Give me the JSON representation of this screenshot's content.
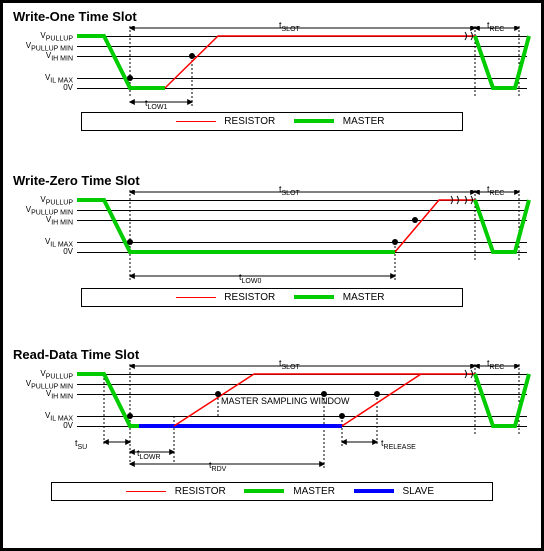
{
  "panels": [
    {
      "title": "Write-One Time Slot",
      "y_labels": [
        "V_PULLUP",
        "V_PULLUP MIN",
        "V_IH MIN",
        "V_IL MAX",
        "0V"
      ],
      "timing_labels": {
        "tslot": "t_SLOT",
        "trec": "t_REC",
        "tlow1": "t_LOW1"
      },
      "legend": [
        {
          "name": "RESISTOR",
          "color": "#ff0000",
          "w": 1
        },
        {
          "name": "MASTER",
          "color": "#00cc00",
          "w": 4
        }
      ]
    },
    {
      "title": "Write-Zero Time Slot",
      "y_labels": [
        "V_PULLUP",
        "V_PULLUP MIN",
        "V_IH MIN",
        "V_IL MAX",
        "0V"
      ],
      "timing_labels": {
        "tslot": "t_SLOT",
        "trec": "t_REC",
        "tlow0": "t_LOW0"
      },
      "legend": [
        {
          "name": "RESISTOR",
          "color": "#ff0000",
          "w": 1
        },
        {
          "name": "MASTER",
          "color": "#00cc00",
          "w": 4
        }
      ]
    },
    {
      "title": "Read-Data Time Slot",
      "y_labels": [
        "V_PULLUP",
        "V_PULLUP MIN",
        "V_IH MIN",
        "V_IL MAX",
        "0V"
      ],
      "timing_labels": {
        "tslot": "t_SLOT",
        "trec": "t_REC",
        "tlowr": "t_LOWR",
        "trdv": "t_RDV",
        "tsu": "t_SU",
        "trelease": "t_RELEASE"
      },
      "sampling_label": "MASTER SAMPLING WINDOW",
      "legend": [
        {
          "name": "RESISTOR",
          "color": "#ff0000",
          "w": 1
        },
        {
          "name": "MASTER",
          "color": "#00cc00",
          "w": 4
        },
        {
          "name": "SLAVE",
          "color": "#0000ff",
          "w": 4
        }
      ]
    }
  ],
  "chart_data": [
    {
      "type": "line",
      "title": "Write-One Time Slot",
      "y_levels": {
        "V_PULLUP": 5,
        "V_PULLUP_MIN": 4.5,
        "V_IH_MIN": 4.0,
        "V_IL_MAX": 1.0,
        "0V": 0
      },
      "x_unit": "normalized t_SLOT",
      "series": [
        {
          "name": "MASTER",
          "color": "#00cc00",
          "points": [
            [
              0,
              5
            ],
            [
              0.06,
              5
            ],
            [
              0.12,
              0
            ],
            [
              0.2,
              0
            ],
            [
              0.2,
              5
            ]
          ]
        },
        {
          "name": "RESISTOR",
          "color": "#ff0000",
          "points": [
            [
              0.2,
              0
            ],
            [
              0.32,
              5
            ],
            [
              0.9,
              5
            ]
          ]
        },
        {
          "name": "MASTER_rec",
          "color": "#00cc00",
          "points": [
            [
              0.9,
              5
            ],
            [
              0.94,
              0
            ],
            [
              1.0,
              0
            ],
            [
              1.0,
              5
            ]
          ]
        }
      ],
      "intervals": {
        "t_SLOT": [
          0.12,
          0.9
        ],
        "t_REC": [
          0.9,
          1.0
        ],
        "t_LOW1": [
          0.12,
          0.26
        ]
      }
    },
    {
      "type": "line",
      "title": "Write-Zero Time Slot",
      "y_levels": {
        "V_PULLUP": 5,
        "V_PULLUP_MIN": 4.5,
        "V_IH_MIN": 4.0,
        "V_IL_MAX": 1.0,
        "0V": 0
      },
      "series": [
        {
          "name": "MASTER",
          "color": "#00cc00",
          "points": [
            [
              0,
              5
            ],
            [
              0.06,
              5
            ],
            [
              0.12,
              0
            ],
            [
              0.72,
              0
            ],
            [
              0.72,
              5
            ]
          ]
        },
        {
          "name": "RESISTOR",
          "color": "#ff0000",
          "points": [
            [
              0.72,
              0
            ],
            [
              0.82,
              5
            ],
            [
              0.9,
              5
            ]
          ]
        },
        {
          "name": "MASTER_rec",
          "color": "#00cc00",
          "points": [
            [
              0.9,
              5
            ],
            [
              0.94,
              0
            ],
            [
              1.0,
              0
            ],
            [
              1.0,
              5
            ]
          ]
        }
      ],
      "intervals": {
        "t_SLOT": [
          0.12,
          0.9
        ],
        "t_REC": [
          0.9,
          1.0
        ],
        "t_LOW0": [
          0.12,
          0.72
        ]
      }
    },
    {
      "type": "line",
      "title": "Read-Data Time Slot",
      "y_levels": {
        "V_PULLUP": 5,
        "V_PULLUP_MIN": 4.5,
        "V_IH_MIN": 4.0,
        "V_IL_MAX": 1.0,
        "0V": 0
      },
      "series": [
        {
          "name": "MASTER",
          "color": "#00cc00",
          "points": [
            [
              0,
              5
            ],
            [
              0.06,
              5
            ],
            [
              0.12,
              0
            ],
            [
              0.22,
              0
            ],
            [
              0.22,
              5
            ]
          ]
        },
        {
          "name": "SLAVE",
          "color": "#0000ff",
          "points": [
            [
              0.14,
              0
            ],
            [
              0.6,
              0
            ]
          ]
        },
        {
          "name": "RESISTOR_early",
          "color": "#ff0000",
          "points": [
            [
              0.22,
              0
            ],
            [
              0.4,
              5
            ],
            [
              0.9,
              5
            ]
          ]
        },
        {
          "name": "RESISTOR_late",
          "color": "#ff0000",
          "points": [
            [
              0.6,
              0
            ],
            [
              0.78,
              5
            ]
          ]
        },
        {
          "name": "MASTER_rec",
          "color": "#00cc00",
          "points": [
            [
              0.9,
              5
            ],
            [
              0.94,
              0
            ],
            [
              1.0,
              0
            ],
            [
              1.0,
              5
            ]
          ]
        }
      ],
      "intervals": {
        "t_SLOT": [
          0.12,
          0.9
        ],
        "t_REC": [
          0.9,
          1.0
        ],
        "t_SU": [
          0.06,
          0.12
        ],
        "t_LOWR": [
          0.12,
          0.22
        ],
        "t_RDV": [
          0.12,
          0.56
        ],
        "t_RELEASE": [
          0.6,
          0.68
        ]
      },
      "master_sampling_window": [
        0.32,
        0.56
      ]
    }
  ]
}
